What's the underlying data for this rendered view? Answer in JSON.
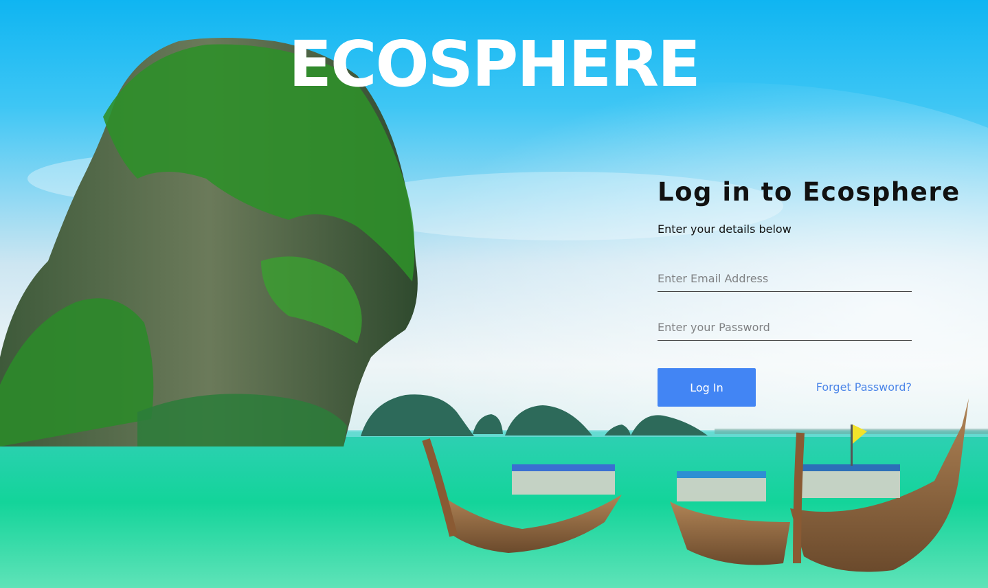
{
  "brand": {
    "title": "ECOSPHERE"
  },
  "login": {
    "title": "Log in to Ecosphere",
    "subtitle": "Enter your details below",
    "email_placeholder": "Enter Email Address",
    "password_placeholder": "Enter your Password",
    "login_button": "Log In",
    "forgot_link": "Forget Password?"
  },
  "colors": {
    "accent": "#4285f4",
    "link": "#4c86e8",
    "sky": "#12b8f2"
  }
}
